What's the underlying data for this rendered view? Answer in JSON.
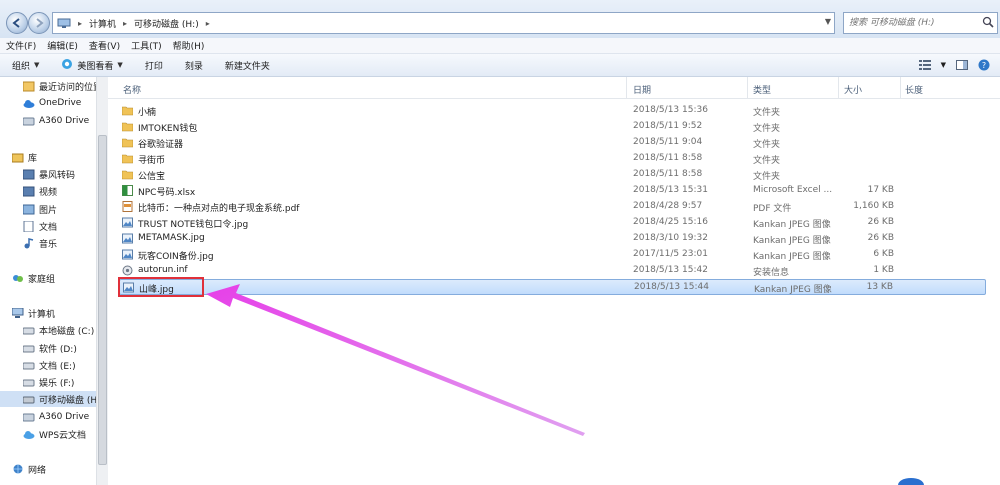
{
  "address": {
    "segments": [
      "计算机",
      "可移动磁盘 (H:)"
    ],
    "search_placeholder": "搜索 可移动磁盘 (H:)"
  },
  "menu": [
    "文件(F)",
    "编辑(E)",
    "查看(V)",
    "工具(T)",
    "帮助(H)"
  ],
  "toolbar": {
    "organize": "组织",
    "viewer": "美图看看",
    "print": "打印",
    "burn": "刻录",
    "new_folder": "新建文件夹"
  },
  "sidebar": [
    {
      "label": "最近访问的位置",
      "icon": "recent-places-icon"
    },
    {
      "label": "OneDrive",
      "icon": "cloud-icon"
    },
    {
      "label": "A360 Drive",
      "icon": "a360-icon"
    },
    {
      "label": "库",
      "icon": "library-icon"
    },
    {
      "label": "暴风转码",
      "icon": "video-library-icon"
    },
    {
      "label": "视频",
      "icon": "video-library-icon"
    },
    {
      "label": "图片",
      "icon": "picture-library-icon"
    },
    {
      "label": "文档",
      "icon": "document-library-icon"
    },
    {
      "label": "音乐",
      "icon": "music-library-icon"
    },
    {
      "label": "家庭组",
      "icon": "homegroup-icon"
    },
    {
      "label": "计算机",
      "icon": "computer-icon"
    },
    {
      "label": "本地磁盘 (C:)",
      "icon": "drive-icon"
    },
    {
      "label": "软件 (D:)",
      "icon": "drive-icon"
    },
    {
      "label": "文档 (E:)",
      "icon": "drive-icon"
    },
    {
      "label": "娱乐 (F:)",
      "icon": "drive-icon"
    },
    {
      "label": "可移动磁盘 (H",
      "icon": "removable-drive-icon"
    },
    {
      "label": "A360 Drive",
      "icon": "a360-icon"
    },
    {
      "label": "WPS云文档",
      "icon": "wps-cloud-icon"
    },
    {
      "label": "网络",
      "icon": "network-icon"
    }
  ],
  "columns": {
    "name": "名称",
    "date": "日期",
    "type": "类型",
    "size": "大小",
    "length": "长度"
  },
  "files": [
    {
      "name": "小楠",
      "date": "2018/5/13 15:36",
      "type": "文件夹",
      "size": "",
      "icon": "folder-icon"
    },
    {
      "name": "IMTOKEN钱包",
      "date": "2018/5/11 9:52",
      "type": "文件夹",
      "size": "",
      "icon": "folder-icon"
    },
    {
      "name": "谷歌验证器",
      "date": "2018/5/11 9:04",
      "type": "文件夹",
      "size": "",
      "icon": "folder-icon"
    },
    {
      "name": "寻街币",
      "date": "2018/5/11 8:58",
      "type": "文件夹",
      "size": "",
      "icon": "folder-icon"
    },
    {
      "name": "公信宝",
      "date": "2018/5/11 8:58",
      "type": "文件夹",
      "size": "",
      "icon": "folder-icon"
    },
    {
      "name": "NPC号码.xlsx",
      "date": "2018/5/13 15:31",
      "type": "Microsoft Excel ...",
      "size": "17 KB",
      "icon": "excel-file-icon"
    },
    {
      "name": "比特币：一种点对点的电子现金系统.pdf",
      "date": "2018/4/28 9:57",
      "type": "PDF 文件",
      "size": "1,160 KB",
      "icon": "pdf-file-icon"
    },
    {
      "name": "TRUST NOTE钱包口令.jpg",
      "date": "2018/4/25 15:16",
      "type": "Kankan JPEG 图像",
      "size": "26 KB",
      "icon": "image-file-icon"
    },
    {
      "name": "METAMASK.jpg",
      "date": "2018/3/10 19:32",
      "type": "Kankan JPEG 图像",
      "size": "26 KB",
      "icon": "image-file-icon"
    },
    {
      "name": "玩客COIN备份.jpg",
      "date": "2017/11/5 23:01",
      "type": "Kankan JPEG 图像",
      "size": "6 KB",
      "icon": "image-file-icon"
    },
    {
      "name": "autorun.inf",
      "date": "2018/5/13 15:42",
      "type": "安装信息",
      "size": "1 KB",
      "icon": "setup-info-icon"
    },
    {
      "name": "山峰.jpg",
      "date": "2018/5/13 15:44",
      "type": "Kankan JPEG 图像",
      "size": "13 KB",
      "icon": "image-file-icon",
      "selected": true
    }
  ],
  "colors": {
    "selection": "#c1dcfc",
    "highlight_box": "#e0303a",
    "arrow": "#e040e8"
  }
}
